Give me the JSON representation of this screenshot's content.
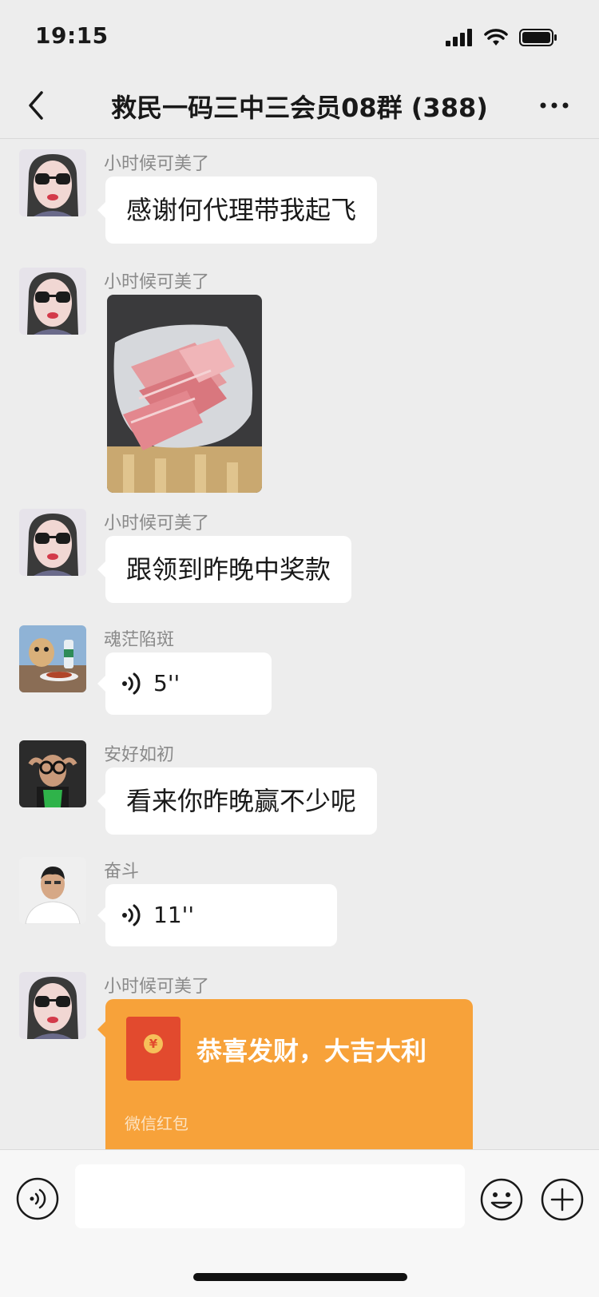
{
  "status_bar": {
    "time": "19:15",
    "icons": [
      "signal-icon",
      "wifi-icon",
      "battery-icon"
    ]
  },
  "nav": {
    "title": "救民一码三中三会员08群 (388)",
    "back_icon": "chevron-left-icon",
    "more_icon": "more-dots-icon"
  },
  "messages": [
    {
      "type": "text",
      "sender": "小时候可美了",
      "text": "感谢何代理带我起飞",
      "avatar": "avatar-sunglasses-woman"
    },
    {
      "type": "image",
      "sender": "小时候可美了",
      "image": "photo-banknotes-in-bag",
      "avatar": "avatar-sunglasses-woman"
    },
    {
      "type": "text",
      "sender": "小时候可美了",
      "text": "跟领到昨晚中奖款",
      "avatar": "avatar-sunglasses-woman"
    },
    {
      "type": "voice",
      "sender": "魂茫陷斑",
      "duration": "5''",
      "avatar": "avatar-dog-table"
    },
    {
      "type": "text",
      "sender": "安好如初",
      "text": "看来你昨晚赢不少呢",
      "avatar": "avatar-man-goggles"
    },
    {
      "type": "voice",
      "sender": "奋斗",
      "duration": "11''",
      "avatar": "avatar-man-white-shirt"
    },
    {
      "type": "red_packet",
      "sender": "小时候可美了",
      "greeting": "恭喜发财，大吉大利",
      "label": "微信红包",
      "avatar": "avatar-sunglasses-woman"
    }
  ],
  "input_bar": {
    "voice_icon": "voice-input-icon",
    "emoji_icon": "emoji-icon",
    "plus_icon": "plus-icon"
  },
  "colors": {
    "background": "#EDEDED",
    "bubble": "#FFFFFF",
    "red_packet": "#F7A23A",
    "sender_name": "#8A8A8A"
  }
}
